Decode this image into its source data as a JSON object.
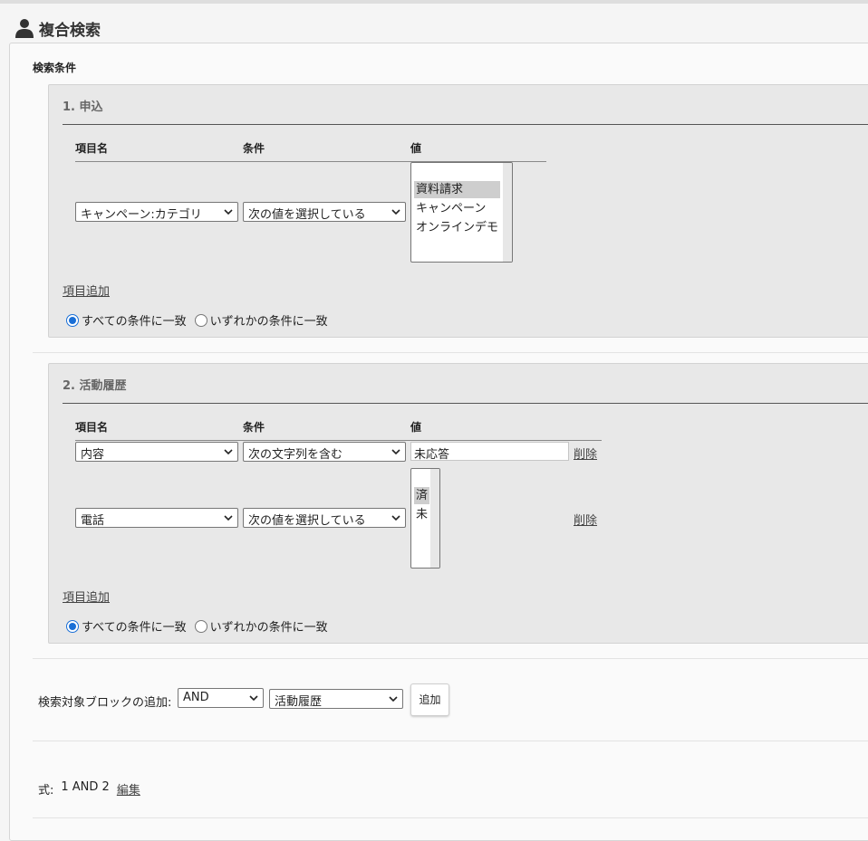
{
  "header": {
    "title": "複合検索",
    "icon": "person-icon"
  },
  "conditions_label": "検索条件",
  "blocks": [
    {
      "title": "1. 申込",
      "columns": [
        "項目名",
        "条件",
        "値"
      ],
      "rows": [
        {
          "field": "キャンペーン:カテゴリ",
          "operator": "次の値を選択している",
          "values": [
            "資料請求",
            "キャンペーン",
            "オンラインデモ"
          ],
          "selected_value": "資料請求"
        }
      ],
      "add_item": "項目追加",
      "match_all": "すべての条件に一致",
      "match_any": "いずれかの条件に一致",
      "match_selected": "all"
    },
    {
      "title": "2. 活動履歴",
      "columns": [
        "項目名",
        "条件",
        "値"
      ],
      "rows": [
        {
          "field": "内容",
          "operator": "次の文字列を含む",
          "text_value": "未応答",
          "delete": "削除"
        },
        {
          "field": "電話",
          "operator": "次の値を選択している",
          "values": [
            "済",
            "未"
          ],
          "selected_value": "済",
          "delete": "削除"
        }
      ],
      "add_item": "項目追加",
      "match_all": "すべての条件に一致",
      "match_any": "いずれかの条件に一致",
      "match_selected": "all"
    }
  ],
  "add_block": {
    "label": "検索対象ブロックの追加:",
    "logic": "AND",
    "target": "活動履歴",
    "button": "追加"
  },
  "formula": {
    "label": "式:",
    "value": "1 AND 2",
    "edit": "編集"
  },
  "colors": {
    "radio_accent": "#1a6fd6",
    "block_bg": "#e8e8e8"
  }
}
